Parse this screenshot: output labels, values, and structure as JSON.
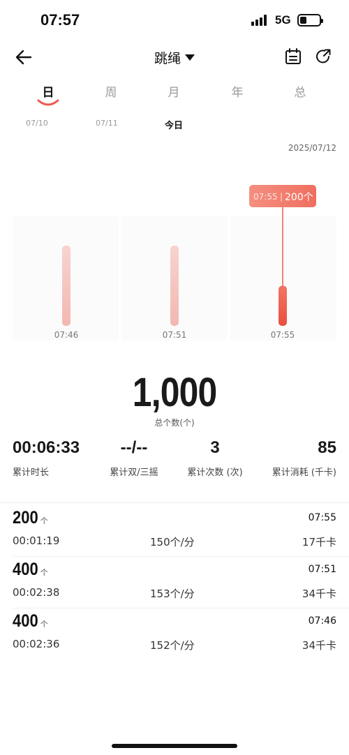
{
  "status_bar": {
    "time": "07:57",
    "network": "5G"
  },
  "nav": {
    "title": "跳绳"
  },
  "tabs": [
    {
      "label": "日",
      "active": true
    },
    {
      "label": "周",
      "active": false
    },
    {
      "label": "月",
      "active": false
    },
    {
      "label": "年",
      "active": false
    },
    {
      "label": "总",
      "active": false
    }
  ],
  "dates": [
    {
      "label": "07/10",
      "active": false
    },
    {
      "label": "07/11",
      "active": false
    },
    {
      "label": "今日",
      "active": true
    }
  ],
  "chart_date": "2025/07/12",
  "chart_data": {
    "type": "bar",
    "categories": [
      "07:46",
      "07:51",
      "07:55"
    ],
    "values": [
      400,
      400,
      200
    ],
    "selected_index": 2,
    "tooltip": {
      "time": "07:55",
      "value": "200个"
    },
    "ylim": [
      0,
      400
    ],
    "colors": {
      "inactive": "#f6c4c0",
      "active": "#ee5a4a",
      "tooltip": "#f07a6a"
    }
  },
  "summary": {
    "total_value": "1,000",
    "total_label": "总个数(个)",
    "stats": [
      {
        "value": "00:06:33",
        "label": "累计时长"
      },
      {
        "value": "--/--",
        "label": "累计双/三摇"
      },
      {
        "value": "3",
        "label": "累计次数 (次)"
      },
      {
        "value": "85",
        "label": "累计消耗 (千卡)"
      }
    ]
  },
  "records": [
    {
      "count": "200",
      "unit": "个",
      "time": "07:55",
      "duration": "00:01:19",
      "rate": "150个/分",
      "kcal": "17千卡"
    },
    {
      "count": "400",
      "unit": "个",
      "time": "07:51",
      "duration": "00:02:38",
      "rate": "153个/分",
      "kcal": "34千卡"
    },
    {
      "count": "400",
      "unit": "个",
      "time": "07:46",
      "duration": "00:02:36",
      "rate": "152个/分",
      "kcal": "34千卡"
    }
  ]
}
